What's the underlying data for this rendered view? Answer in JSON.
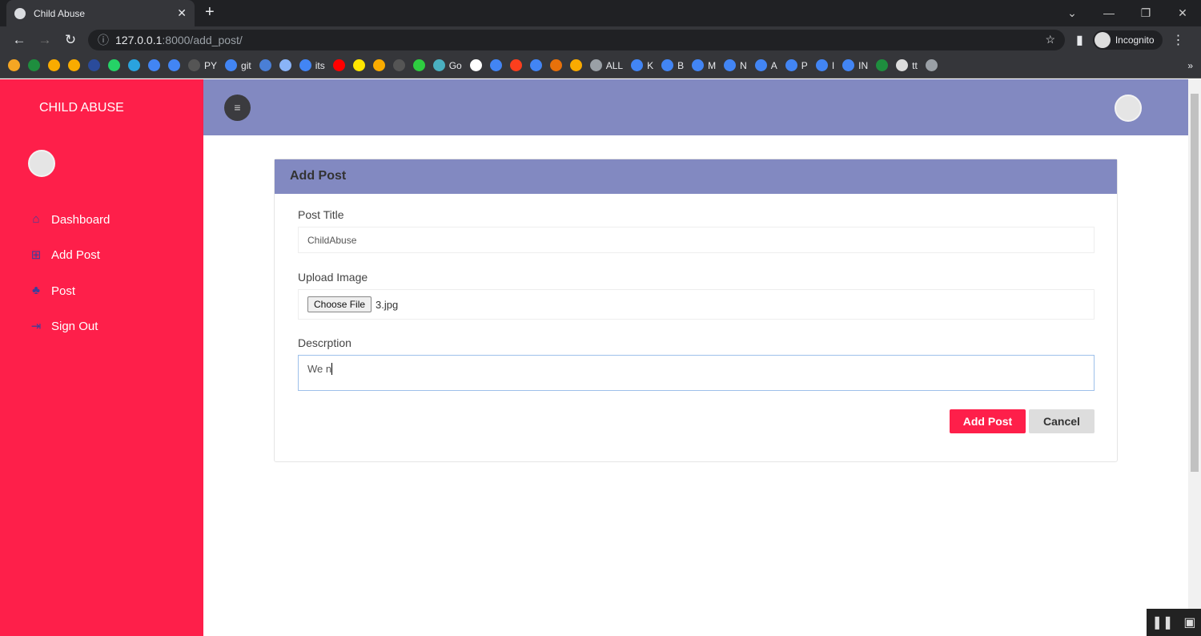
{
  "browser": {
    "tab_title": "Child Abuse",
    "url_host": "127.0.0.1",
    "url_path": ":8000/add_post/",
    "profile": "Incognito",
    "bookmarks": [
      {
        "label": "",
        "color": "#f5a623"
      },
      {
        "label": "",
        "color": "#1e8e3e"
      },
      {
        "label": "",
        "color": "#f9ab00"
      },
      {
        "label": "",
        "color": "#f9ab00"
      },
      {
        "label": "",
        "color": "#2a4b9b"
      },
      {
        "label": "",
        "color": "#25d366"
      },
      {
        "label": "",
        "color": "#2aa3df"
      },
      {
        "label": "",
        "color": "#4285f4"
      },
      {
        "label": "",
        "color": "#4285f4"
      },
      {
        "label": "PY",
        "color": "#555"
      },
      {
        "label": "git",
        "color": "#4285f4"
      },
      {
        "label": "",
        "color": "#4a7fd6"
      },
      {
        "label": "",
        "color": "#8ab4f8"
      },
      {
        "label": "its",
        "color": "#4285f4"
      },
      {
        "label": "",
        "color": "#ff0000"
      },
      {
        "label": "",
        "color": "#ffe600"
      },
      {
        "label": "",
        "color": "#f9ab00"
      },
      {
        "label": "",
        "color": "#555"
      },
      {
        "label": "",
        "color": "#2ecc40"
      },
      {
        "label": "Go",
        "color": "#4ab0c1"
      },
      {
        "label": "",
        "color": "#fff"
      },
      {
        "label": "",
        "color": "#4285f4"
      },
      {
        "label": "",
        "color": "#fc3f1d"
      },
      {
        "label": "",
        "color": "#4285f4"
      },
      {
        "label": "",
        "color": "#e8710a"
      },
      {
        "label": "",
        "color": "#f9ab00"
      },
      {
        "label": "ALL",
        "color": "#9aa0a6"
      },
      {
        "label": "K",
        "color": "#4285f4"
      },
      {
        "label": "B",
        "color": "#4285f4"
      },
      {
        "label": "M",
        "color": "#4285f4"
      },
      {
        "label": "N",
        "color": "#4285f4"
      },
      {
        "label": "A",
        "color": "#4285f4"
      },
      {
        "label": "P",
        "color": "#4285f4"
      },
      {
        "label": "I",
        "color": "#4285f4"
      },
      {
        "label": "IN",
        "color": "#4285f4"
      },
      {
        "label": "",
        "color": "#1e8e3e"
      },
      {
        "label": "tt",
        "color": "#ddd"
      },
      {
        "label": "",
        "color": "#9aa0a6"
      }
    ],
    "more": "»"
  },
  "sidebar": {
    "brand": "CHILD ABUSE",
    "items": [
      {
        "label": "Dashboard",
        "icon": "⌂"
      },
      {
        "label": "Add Post",
        "icon": "⊞"
      },
      {
        "label": "Post",
        "icon": "♣"
      },
      {
        "label": "Sign Out",
        "icon": "⇥"
      }
    ]
  },
  "form": {
    "title": "Add Post",
    "post_title_label": "Post Title",
    "post_title_value": "ChildAbuse",
    "upload_label": "Upload Image",
    "choose_file": "Choose File",
    "file_name": "3.jpg",
    "description_label": "Descrption",
    "description_value": "We n",
    "submit": "Add Post",
    "cancel": "Cancel"
  },
  "colors": {
    "sidebar": "#fe1f4a",
    "header": "#8289c1"
  }
}
